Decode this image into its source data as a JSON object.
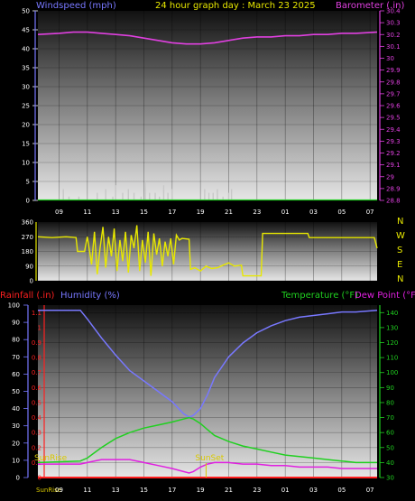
{
  "header": {
    "windspeed_label": "Windspeed (mph)",
    "title": "24 hour graph day : March 23 2025",
    "barometer_label": "Barometer (.in)"
  },
  "lower_header": {
    "rainfall_label": "Rainfall (.in)",
    "humidity_label": "Humidity (%)",
    "temperature_label": "Temperature (°F)",
    "dewpoint_label": "Dew Point (°F)"
  },
  "colors": {
    "windspeed": "#c8c8c8",
    "barometer": "#e040e0",
    "wind_direction": "#e8e800",
    "humidity": "#7878ff",
    "temperature": "#20d020",
    "dewpoint": "#e020e0",
    "rainfall": "#ff2020",
    "title": "#e8e800",
    "sun": "#d8c800"
  },
  "compass": [
    "N",
    "W",
    "S",
    "E",
    "N"
  ],
  "time_ticks": [
    "09",
    "11",
    "13",
    "15",
    "17",
    "19",
    "21",
    "23",
    "01",
    "03",
    "05",
    "07"
  ],
  "sunrise_label": "SunRise",
  "sunset_label": "SunSet",
  "chart_data": [
    {
      "type": "line",
      "name": "wind-baro",
      "x_range_hours": [
        7.5,
        31.5
      ],
      "left_axis": {
        "label": "Windspeed (mph)",
        "ticks": [
          0,
          5,
          10,
          15,
          20,
          25,
          30,
          35,
          40,
          45,
          50
        ],
        "range": [
          0,
          50
        ]
      },
      "right_axis": {
        "label": "Barometer (.in)",
        "ticks": [
          "28.8",
          "28.9",
          "29",
          "29.1",
          "29.2",
          "29.3",
          "29.4",
          "29.5",
          "29.6",
          "29.7",
          "29.8",
          "29.9",
          "30",
          "30.1",
          "30.2",
          "30.3",
          "30.4"
        ],
        "range": [
          28.8,
          30.4
        ]
      },
      "series": [
        {
          "name": "Barometer",
          "x": [
            7.5,
            9,
            10,
            11,
            12,
            13,
            14,
            15,
            16,
            17,
            18,
            19,
            20,
            21,
            22,
            23,
            24,
            25,
            26,
            27,
            28,
            29,
            30,
            31.5
          ],
          "y": [
            30.2,
            30.21,
            30.22,
            30.22,
            30.21,
            30.2,
            30.19,
            30.17,
            30.15,
            30.13,
            30.12,
            30.12,
            30.13,
            30.15,
            30.17,
            30.18,
            30.18,
            30.19,
            30.19,
            30.2,
            30.2,
            30.21,
            30.21,
            30.22
          ]
        },
        {
          "name": "Windspeed",
          "bars": [
            [
              9.3,
              3
            ],
            [
              9.7,
              1
            ],
            [
              10.4,
              1
            ],
            [
              11.7,
              2
            ],
            [
              12.3,
              3
            ],
            [
              12.8,
              1
            ],
            [
              13.0,
              4
            ],
            [
              13.5,
              2
            ],
            [
              13.9,
              3
            ],
            [
              14.3,
              2
            ],
            [
              14.8,
              1
            ],
            [
              15.1,
              5
            ],
            [
              15.4,
              2
            ],
            [
              15.8,
              2
            ],
            [
              16.1,
              1
            ],
            [
              16.4,
              4
            ],
            [
              16.7,
              2
            ],
            [
              17.0,
              3
            ],
            [
              19.3,
              3
            ],
            [
              19.6,
              2
            ],
            [
              19.9,
              2
            ],
            [
              20.2,
              3
            ],
            [
              20.6,
              1
            ],
            [
              21.0,
              2
            ],
            [
              21.2,
              3
            ]
          ]
        }
      ]
    },
    {
      "type": "line",
      "name": "wind-direction",
      "x_range_hours": [
        7.5,
        31.5
      ],
      "left_axis": {
        "ticks": [
          0,
          90,
          180,
          270,
          360
        ],
        "range": [
          0,
          360
        ]
      },
      "series": [
        {
          "name": "Wind Direction",
          "x": [
            7.5,
            8.5,
            9.5,
            10.2,
            10.3,
            10.8,
            11.0,
            11.3,
            11.5,
            11.7,
            11.9,
            12.1,
            12.3,
            12.5,
            12.7,
            12.9,
            13.1,
            13.3,
            13.5,
            13.7,
            13.9,
            14.1,
            14.3,
            14.5,
            14.7,
            14.9,
            15.1,
            15.3,
            15.5,
            15.7,
            15.9,
            16.1,
            16.3,
            16.5,
            16.7,
            16.9,
            17.1,
            17.3,
            17.5,
            17.7,
            18.2,
            18.3,
            18.6,
            19.0,
            19.4,
            19.8,
            20.2,
            20.6,
            21.0,
            21.4,
            21.9,
            22.0,
            23.3,
            23.4,
            24.5,
            25.5,
            26.6,
            26.7,
            28.0,
            29.5,
            31.3,
            31.5
          ],
          "y": [
            270,
            265,
            270,
            265,
            180,
            180,
            270,
            100,
            300,
            40,
            200,
            330,
            80,
            270,
            150,
            320,
            60,
            250,
            120,
            300,
            50,
            280,
            200,
            340,
            60,
            250,
            110,
            300,
            30,
            290,
            160,
            260,
            90,
            240,
            150,
            260,
            100,
            280,
            250,
            260,
            255,
            70,
            80,
            60,
            90,
            75,
            80,
            95,
            110,
            90,
            95,
            30,
            30,
            290,
            290,
            290,
            290,
            265,
            265,
            265,
            265,
            200
          ]
        }
      ]
    },
    {
      "type": "line",
      "name": "humidity-temperature",
      "x_range_hours": [
        7.5,
        31.5
      ],
      "left_axis": {
        "label": "Rainfall (.in) / Humidity (%)",
        "ticks": [
          0,
          10,
          20,
          30,
          40,
          50,
          60,
          70,
          80,
          90,
          100
        ],
        "range": [
          0,
          100
        ]
      },
      "rain_axis": {
        "ticks": [
          "0",
          "0.1",
          "0.2",
          "0.3",
          "0.4",
          "0.5",
          "0.6",
          "0.7",
          "0.8",
          "0.9",
          "1",
          "1.1"
        ],
        "range": [
          0,
          1.15
        ]
      },
      "right_axis": {
        "label": "Temperature (°F) Dew Point (°F)",
        "ticks": [
          30,
          40,
          50,
          60,
          70,
          80,
          90,
          100,
          110,
          120,
          130,
          140
        ],
        "range": [
          30,
          145
        ]
      },
      "series": [
        {
          "name": "Humidity",
          "axis": "left",
          "x": [
            7.5,
            10.5,
            11.0,
            12.0,
            13.0,
            14.0,
            15.0,
            16.0,
            17.0,
            17.8,
            18.2,
            18.5,
            19.0,
            19.5,
            20.0,
            21.0,
            22.0,
            23.0,
            24.0,
            25.0,
            26.0,
            27.0,
            28.0,
            29.0,
            30.0,
            31.5
          ],
          "y": [
            97,
            97,
            92,
            81,
            71,
            62,
            56,
            50,
            44,
            37,
            35,
            36,
            40,
            48,
            58,
            70,
            78,
            84,
            88,
            91,
            93,
            94,
            95,
            96,
            96,
            97
          ]
        },
        {
          "name": "Temperature",
          "axis": "right",
          "x": [
            7.5,
            10.5,
            11.0,
            12.0,
            13.0,
            14.0,
            15.0,
            16.0,
            17.0,
            17.8,
            18.2,
            18.5,
            19.0,
            19.5,
            20.0,
            21.0,
            22.0,
            23.0,
            24.0,
            25.0,
            26.0,
            27.0,
            28.0,
            29.0,
            30.0,
            31.5
          ],
          "y": [
            40,
            41,
            43,
            50,
            56,
            60,
            63,
            65,
            67,
            69,
            70,
            69,
            66,
            62,
            58,
            54,
            51,
            49,
            47,
            45,
            44,
            43,
            42,
            41,
            40,
            40
          ]
        },
        {
          "name": "Dew Point",
          "axis": "right",
          "x": [
            7.5,
            10.5,
            11.0,
            12.0,
            13.0,
            14.0,
            15.0,
            16.0,
            17.0,
            17.8,
            18.2,
            18.5,
            19.0,
            19.5,
            20.0,
            21.0,
            22.0,
            23.0,
            24.0,
            25.0,
            26.0,
            27.0,
            28.0,
            29.0,
            30.0,
            31.5
          ],
          "y": [
            39,
            39,
            40,
            42,
            42,
            42,
            40,
            38,
            36,
            34,
            33,
            34,
            37,
            39,
            40,
            40,
            39,
            39,
            38,
            38,
            37,
            37,
            37,
            36,
            36,
            36
          ]
        },
        {
          "name": "Rainfall",
          "axis": "rain",
          "x": [
            7.5,
            31.5
          ],
          "y": [
            0,
            0
          ]
        }
      ],
      "markers": [
        {
          "label": "SunRise",
          "x": 7.5
        },
        {
          "label": "SunSet",
          "x": 19.4
        }
      ]
    }
  ]
}
